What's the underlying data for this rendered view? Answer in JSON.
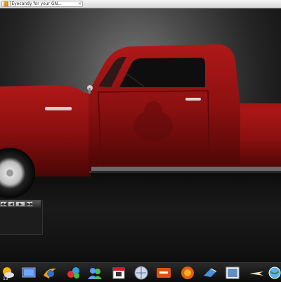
{
  "browser": {
    "tab_title": "[Eyecandy for your GN...",
    "tab_close": "×"
  },
  "media_player": {
    "buttons": [
      "◀◀",
      "◀",
      "▶",
      "▶▶"
    ]
  },
  "dock": {
    "weather_temp": "19°",
    "items": [
      {
        "icon": "weather-icon"
      },
      {
        "icon": "desktop-icon"
      },
      {
        "icon": "browser-icon"
      },
      {
        "icon": "gems-icon"
      },
      {
        "icon": "contacts-icon"
      },
      {
        "icon": "calendar-icon"
      },
      {
        "icon": "web-icon"
      },
      {
        "icon": "media-app-icon"
      },
      {
        "icon": "firefox-icon"
      },
      {
        "icon": "mail-icon"
      },
      {
        "icon": "picture-icon"
      },
      {
        "icon": "airplane-icon"
      },
      {
        "icon": "globe-icon"
      }
    ]
  }
}
